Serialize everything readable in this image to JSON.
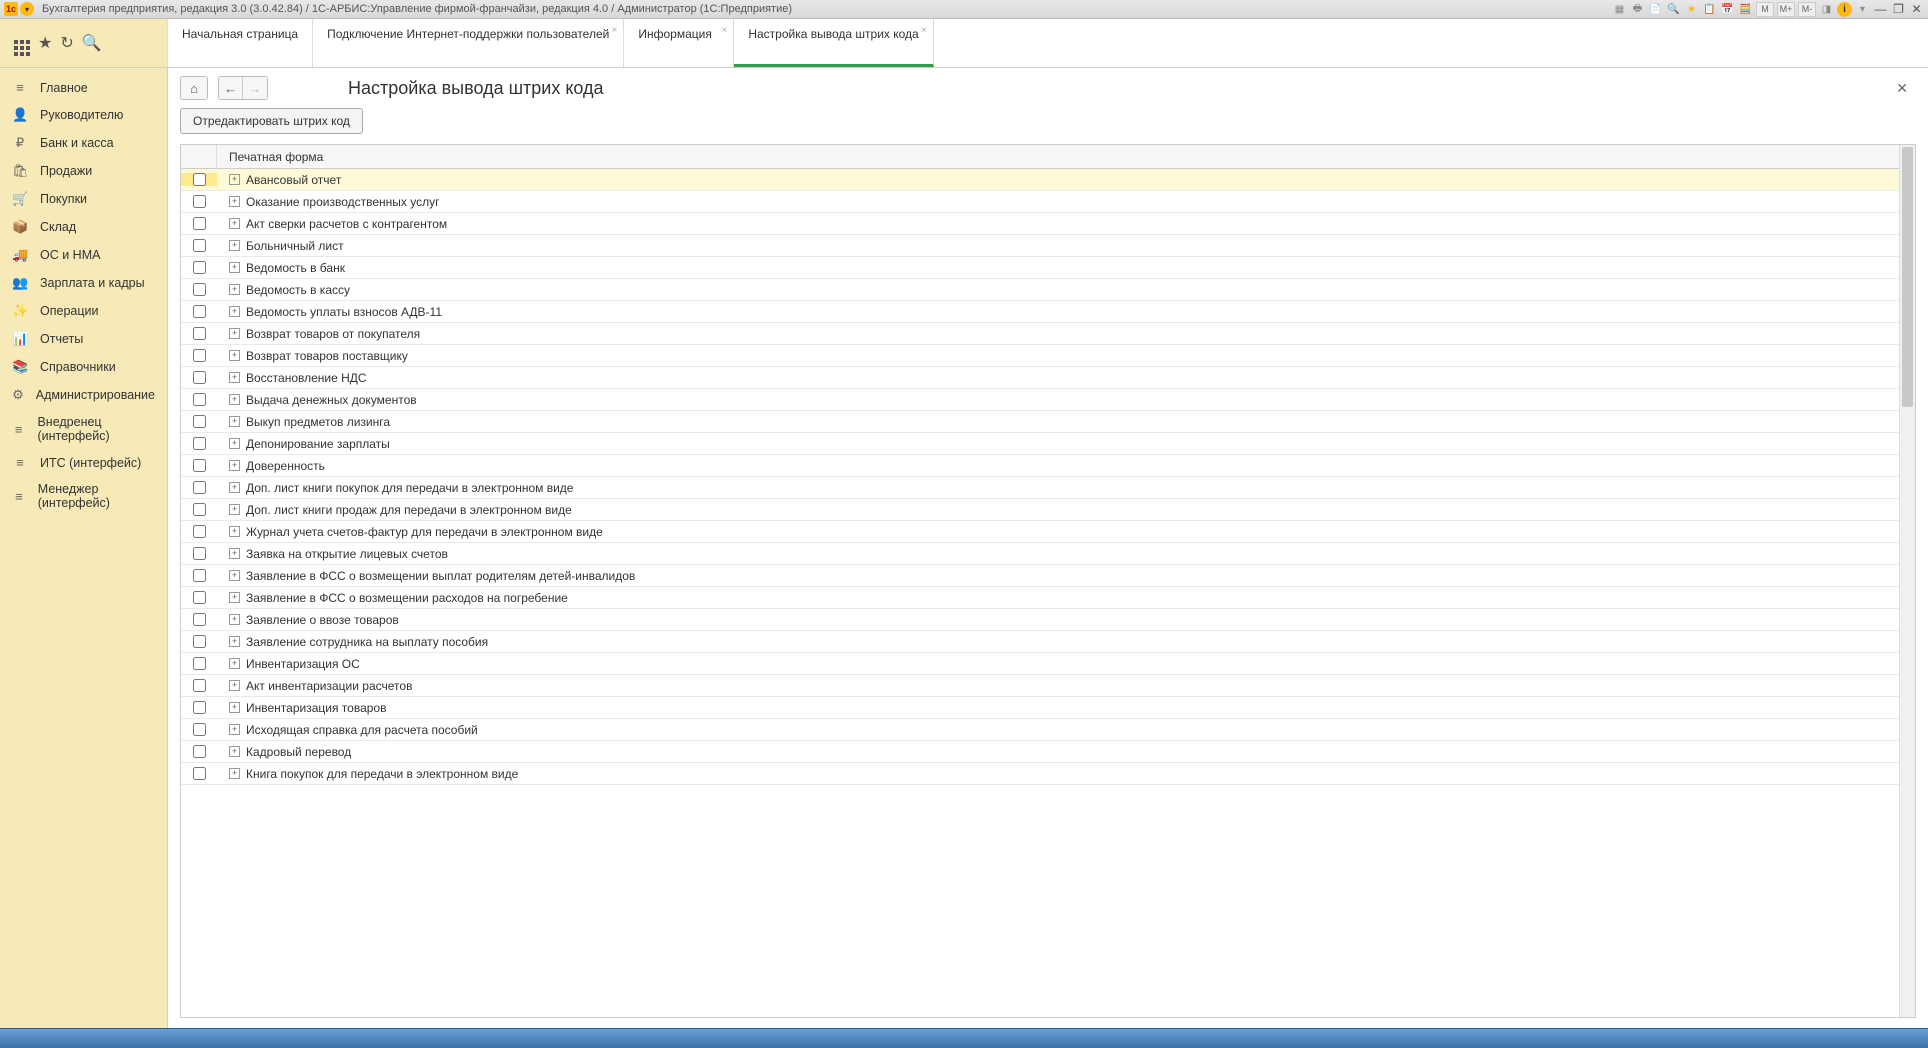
{
  "titlebar": {
    "text": "Бухгалтерия предприятия, редакция 3.0 (3.0.42.84) / 1С-АРБИС:Управление фирмой-франчайзи, редакция 4.0 / Администратор  (1С:Предприятие)",
    "m_labels": [
      "M",
      "M+",
      "M-"
    ]
  },
  "tabs": [
    {
      "label": "Начальная страница",
      "closable": false
    },
    {
      "label": "Подключение Интернет-поддержки пользователей",
      "closable": true
    },
    {
      "label": "Информация",
      "closable": true
    },
    {
      "label": "Настройка вывода штрих кода",
      "closable": true,
      "active": true
    }
  ],
  "sidebar": [
    {
      "icon": "≡",
      "label": "Главное"
    },
    {
      "icon": "👤",
      "label": "Руководителю"
    },
    {
      "icon": "₽",
      "label": "Банк и касса"
    },
    {
      "icon": "🛍",
      "label": "Продажи"
    },
    {
      "icon": "🛒",
      "label": "Покупки"
    },
    {
      "icon": "📦",
      "label": "Склад"
    },
    {
      "icon": "🚚",
      "label": "ОС и НМА"
    },
    {
      "icon": "👥",
      "label": "Зарплата и кадры"
    },
    {
      "icon": "✨",
      "label": "Операции"
    },
    {
      "icon": "📊",
      "label": "Отчеты"
    },
    {
      "icon": "📚",
      "label": "Справочники"
    },
    {
      "icon": "⚙",
      "label": "Администрирование"
    },
    {
      "icon": "≡",
      "label": "Внедренец (интерфейс)"
    },
    {
      "icon": "≡",
      "label": "ИТС (интерфейс)"
    },
    {
      "icon": "≡",
      "label": "Менеджер (интерфейс)"
    }
  ],
  "page": {
    "title": "Настройка вывода штрих кода",
    "edit_button": "Отредактировать штрих код",
    "column_header": "Печатная форма"
  },
  "rows": [
    {
      "name": "Авансовый отчет",
      "selected": true
    },
    {
      "name": "Оказание производственных услуг"
    },
    {
      "name": "Акт сверки расчетов с контрагентом"
    },
    {
      "name": "Больничный лист"
    },
    {
      "name": "Ведомость в банк"
    },
    {
      "name": "Ведомость в кассу"
    },
    {
      "name": "Ведомость уплаты взносов АДВ-11"
    },
    {
      "name": "Возврат товаров от покупателя"
    },
    {
      "name": "Возврат товаров поставщику"
    },
    {
      "name": "Восстановление НДС"
    },
    {
      "name": "Выдача денежных документов"
    },
    {
      "name": "Выкуп предметов лизинга"
    },
    {
      "name": "Депонирование зарплаты"
    },
    {
      "name": "Доверенность"
    },
    {
      "name": "Доп. лист книги покупок для передачи в электронном виде"
    },
    {
      "name": "Доп. лист книги продаж для передачи в электронном виде"
    },
    {
      "name": "Журнал учета счетов-фактур для передачи в электронном виде"
    },
    {
      "name": "Заявка на открытие лицевых счетов"
    },
    {
      "name": "Заявление в ФСС о возмещении выплат родителям детей-инвалидов"
    },
    {
      "name": "Заявление в ФСС о возмещении расходов на погребение"
    },
    {
      "name": "Заявление о ввозе товаров"
    },
    {
      "name": "Заявление сотрудника на выплату пособия"
    },
    {
      "name": "Инвентаризация ОС"
    },
    {
      "name": "Акт инвентаризации расчетов"
    },
    {
      "name": "Инвентаризация товаров"
    },
    {
      "name": "Исходящая справка для расчета пособий"
    },
    {
      "name": "Кадровый перевод"
    },
    {
      "name": "Книга покупок для передачи в электронном виде"
    }
  ]
}
